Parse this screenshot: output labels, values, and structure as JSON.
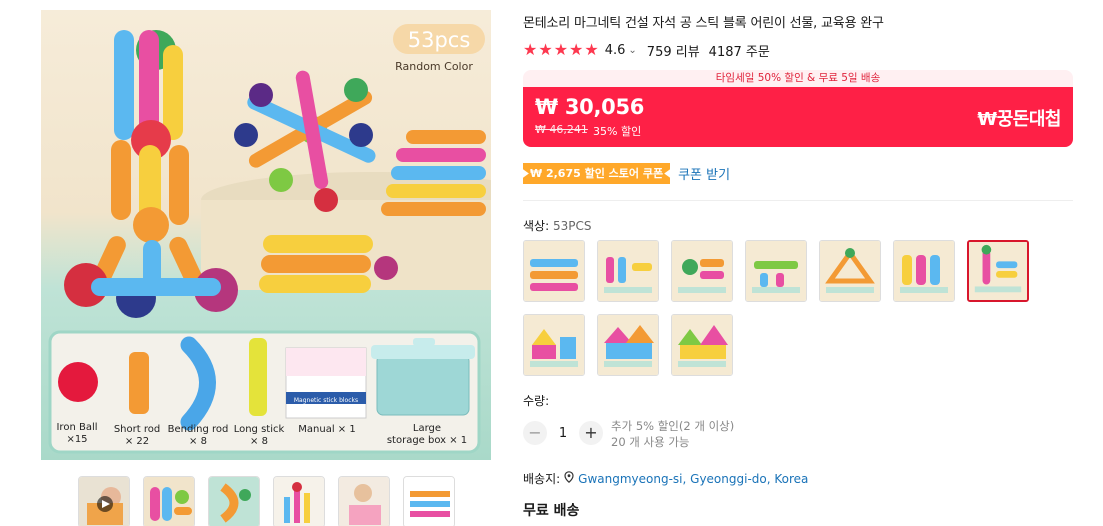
{
  "product": {
    "title": "몬테소리 마그네틱 건설 자석 공 스틱 블록 어린이 선물, 교육용 완구",
    "rating": "4.6",
    "rating_stars": 5,
    "reviews": "759 리뷰",
    "orders": "4187 주문"
  },
  "image": {
    "pcs_badge": "53pcs",
    "badge_sub": "Random Color",
    "components": [
      {
        "label": "Iron Ball",
        "qty": "×15"
      },
      {
        "label": "Short rod",
        "qty": "× 22"
      },
      {
        "label": "Bending rod",
        "qty": "× 8"
      },
      {
        "label": "Long stick",
        "qty": "× 8"
      },
      {
        "label": "Manual × 1",
        "qty": ""
      },
      {
        "label": "Large",
        "qty": "storage box × 1"
      }
    ],
    "manual_title": "Magnetic stick blocks"
  },
  "promo": {
    "banner": "타임세일 50% 할인 & 무료 5일 배송",
    "price": "₩ 30,056",
    "original_price": "₩ 46,241",
    "discount": "35% 할인",
    "event_logo": "₩꿍돈대첩"
  },
  "coupon": {
    "badge": "₩ 2,675 할인 스토어 쿠폰",
    "link": "쿠폰 받기"
  },
  "color": {
    "label": "색상: ",
    "value": "53PCS"
  },
  "quantity": {
    "label": "수량:",
    "value": "1",
    "minus": "−",
    "plus": "+",
    "info_line1": "추가 5% 할인(2 개 이상)",
    "info_line2": "20 개 사용 가능"
  },
  "shipping": {
    "label": "배송지: ",
    "location": "Gwangmyeong-si, Gyeonggi-do, Korea",
    "free": "무료 배송"
  },
  "colors": {
    "accent_red": "#fe2046",
    "star": "#fd384f",
    "coupon_orange": "#ffa82a",
    "link_blue": "#1a73b8"
  }
}
